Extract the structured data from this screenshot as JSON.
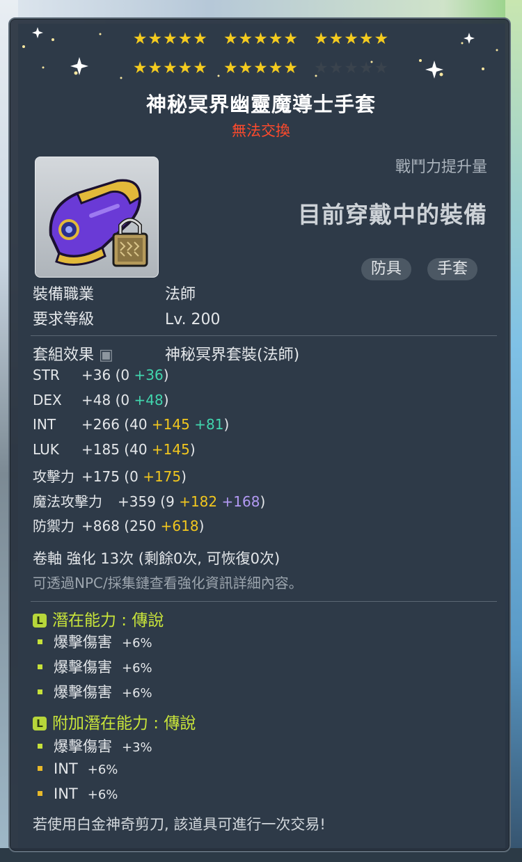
{
  "stars": {
    "row1": [
      5,
      5,
      5
    ],
    "row2_filled": [
      5,
      5,
      0
    ]
  },
  "item": {
    "name": "神秘冥界幽靈魔導士手套",
    "trade_status": "無法交換",
    "cp_label": "戰鬥力提升量",
    "equipped_text": "目前穿戴中的裝備",
    "tags": [
      "防具",
      "手套"
    ]
  },
  "info": [
    {
      "k": "裝備職業",
      "v": "法師"
    },
    {
      "k": "要求等級",
      "v": "Lv. 200"
    }
  ],
  "set_effect": {
    "label": "套組效果",
    "value": "神秘冥界套裝(法師)"
  },
  "stats": [
    {
      "name": "STR",
      "total": "+36",
      "base": "0",
      "bonus": [
        {
          "v": "+36",
          "c": "gr"
        }
      ]
    },
    {
      "name": "DEX",
      "total": "+48",
      "base": "0",
      "bonus": [
        {
          "v": "+48",
          "c": "gr"
        }
      ]
    },
    {
      "name": "INT",
      "total": "+266",
      "base": "40",
      "bonus": [
        {
          "v": "+145",
          "c": "yl"
        },
        {
          "v": "+81",
          "c": "gr"
        }
      ]
    },
    {
      "name": "LUK",
      "total": "+185",
      "base": "40",
      "bonus": [
        {
          "v": "+145",
          "c": "yl"
        }
      ]
    },
    {
      "name": "攻擊力",
      "total": "+175",
      "base": "0",
      "bonus": [
        {
          "v": "+175",
          "c": "yl"
        }
      ]
    },
    {
      "name": "魔法攻擊力",
      "total": "+359",
      "base": "9",
      "bonus": [
        {
          "v": "+182",
          "c": "yl"
        },
        {
          "v": "+168",
          "c": "pu"
        }
      ]
    },
    {
      "name": "防禦力",
      "total": "+868",
      "base": "250",
      "bonus": [
        {
          "v": "+618",
          "c": "yl"
        }
      ]
    }
  ],
  "scroll": "卷軸 強化 13次 (剩餘0次, 可恢復0次)",
  "note": "可透過NPC/採集鏈查看強化資訊詳細內容。",
  "potential": {
    "header": "潛在能力 : 傳說",
    "lines": [
      {
        "name": "爆擊傷害",
        "value": "+6%"
      },
      {
        "name": "爆擊傷害",
        "value": "+6%"
      },
      {
        "name": "爆擊傷害",
        "value": "+6%"
      }
    ]
  },
  "additional": {
    "header": "附加潛在能力 : 傳說",
    "lines": [
      {
        "name": "爆擊傷害",
        "value": "+3%"
      },
      {
        "name": "INT",
        "value": "+6%"
      },
      {
        "name": "INT",
        "value": "+6%"
      }
    ]
  },
  "footer": "若使用白金神奇剪刀, 該道具可進行一次交易!",
  "colors": {
    "star": "#f4cb1f",
    "untradable": "#ff4a2c",
    "legendary": "#c9e53a",
    "green": "#41d6ae",
    "yellow": "#f2c71e",
    "purple": "#b39af4"
  }
}
